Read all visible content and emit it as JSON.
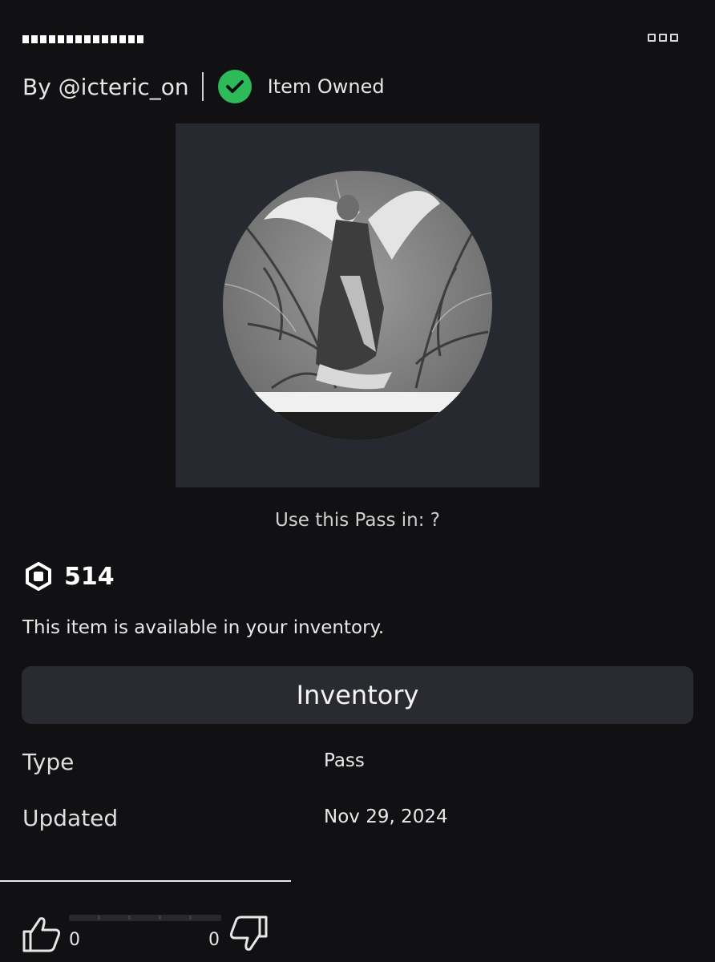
{
  "header": {
    "title": "■■■■■■■■■■■■■■",
    "by_text": "By @icteric_on",
    "owned_label": "Item Owned",
    "more_icon": "more-options-icon"
  },
  "item": {
    "image_icon": "angel-statue-thumbnail",
    "use_in_text": "Use this Pass in: ?",
    "price": "514",
    "currency_icon": "robux-icon",
    "availability_text": "This item is available in your inventory.",
    "inventory_button_label": "Inventory"
  },
  "details": [
    {
      "label": "Type",
      "value": "Pass"
    },
    {
      "label": "Updated",
      "value": "Nov 29, 2024"
    }
  ],
  "votes": {
    "up_count": "0",
    "down_count": "0",
    "up_icon": "thumbs-up-icon",
    "down_icon": "thumbs-down-icon"
  },
  "colors": {
    "background": "#111114",
    "owned_green": "#2dbb5a",
    "button_bg": "#2a2b31",
    "thumb_bg": "#262930"
  }
}
